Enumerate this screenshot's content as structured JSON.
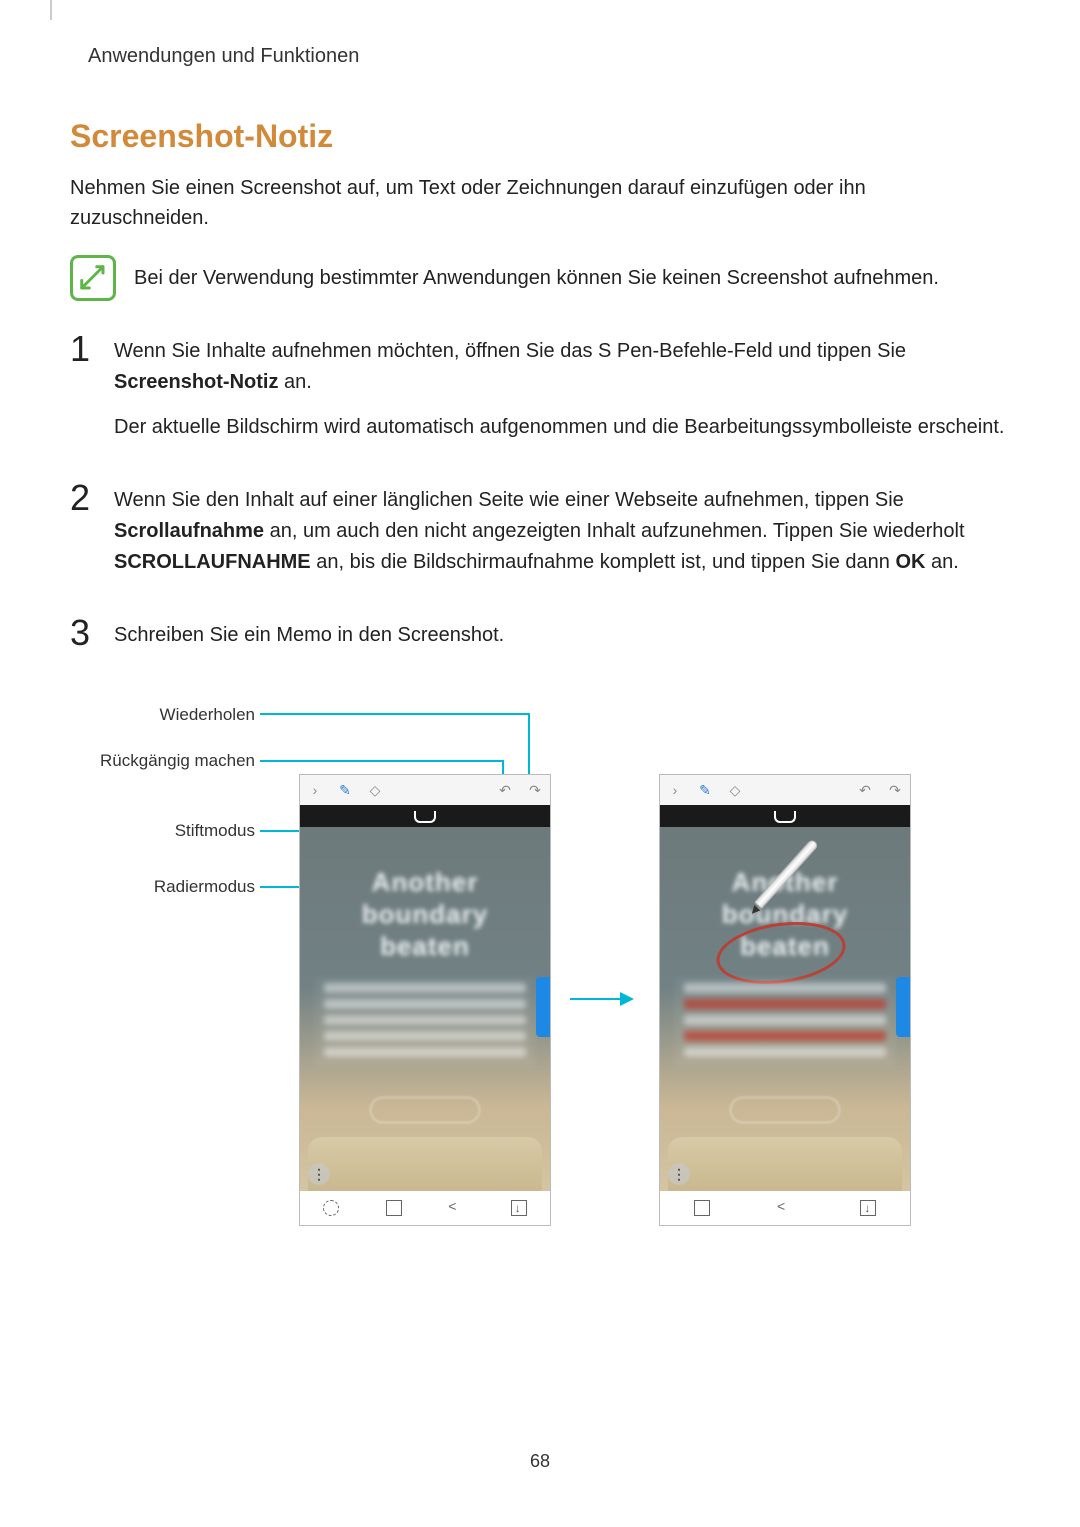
{
  "page": {
    "chapter": "Anwendungen und Funktionen",
    "title": "Screenshot-Notiz",
    "intro": "Nehmen Sie einen Screenshot auf, um Text oder Zeichnungen darauf einzufügen oder ihn zuzuschneiden.",
    "note": "Bei der Verwendung bestimmter Anwendungen können Sie keinen Screenshot aufnehmen.",
    "page_number": "68"
  },
  "steps": {
    "s1": {
      "num": "1",
      "p1a": "Wenn Sie Inhalte aufnehmen möchten, öffnen Sie das S Pen-Befehle-Feld und tippen Sie ",
      "p1b": "Screenshot-Notiz",
      "p1c": " an.",
      "p2": "Der aktuelle Bildschirm wird automatisch aufgenommen und die Bearbeitungssymbolleiste erscheint."
    },
    "s2": {
      "num": "2",
      "p1a": "Wenn Sie den Inhalt auf einer länglichen Seite wie einer Webseite aufnehmen, tippen Sie ",
      "p1b": "Scrollaufnahme",
      "p1c": " an, um auch den nicht angezeigten Inhalt aufzunehmen. Tippen Sie wiederholt ",
      "p1d": "SCROLLAUFNAHME",
      "p1e": " an, bis die Bildschirmaufnahme komplett ist, und tippen Sie dann ",
      "p1f": "OK",
      "p1g": " an."
    },
    "s3": {
      "num": "3",
      "p1": "Schreiben Sie ein Memo in den Screenshot."
    }
  },
  "labels": {
    "redo": "Wiederholen",
    "undo": "Rückgängig machen",
    "pen": "Stiftmodus",
    "eraser": "Radiermodus"
  },
  "mock": {
    "t1": "Another",
    "t2": "boundary",
    "t3": "beaten"
  }
}
